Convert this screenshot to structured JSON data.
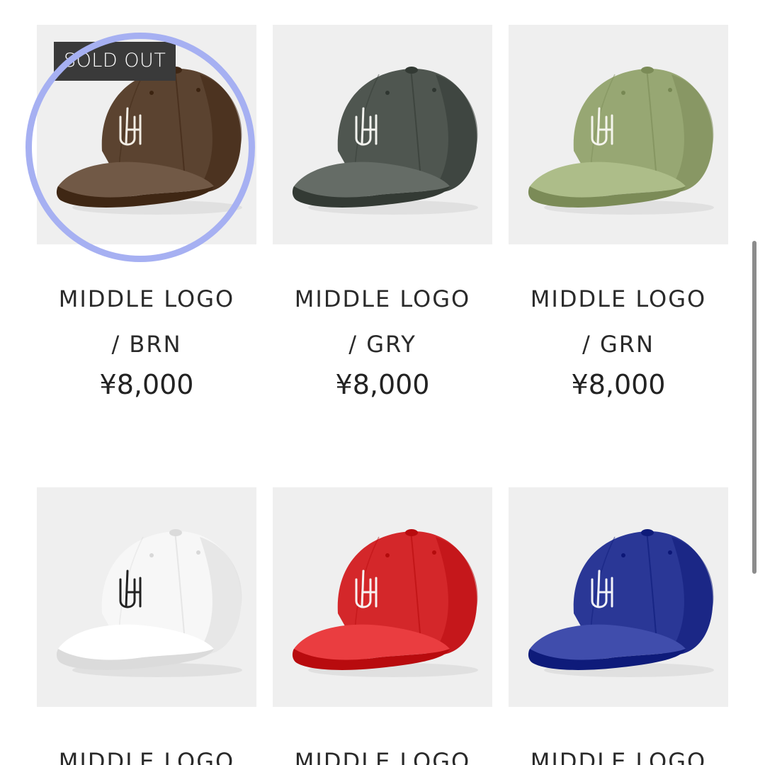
{
  "products": [
    {
      "name_line1": "MIDDLE LOGO",
      "name_line2": "/ BRN",
      "price": "¥8,000",
      "badge": "SOLD OUT",
      "cap_color": "#5b4330",
      "logo_color": "#f2ede4"
    },
    {
      "name_line1": "MIDDLE LOGO",
      "name_line2": "/ GRY",
      "price": "¥8,000",
      "cap_color": "#4f5650",
      "logo_color": "#f2f2ee"
    },
    {
      "name_line1": "MIDDLE LOGO",
      "name_line2": "/ GRN",
      "price": "¥8,000",
      "cap_color": "#97a773",
      "logo_color": "#f4f4ec"
    },
    {
      "name_line1": "MIDDLE LOGO",
      "cap_color": "#f7f7f7",
      "logo_color": "#222222"
    },
    {
      "name_line1": "MIDDLE LOGO",
      "cap_color": "#d4272a",
      "logo_color": "#f7f1f1"
    },
    {
      "name_line1": "MIDDLE LOGO",
      "cap_color": "#2a3796",
      "logo_color": "#f1f2f8"
    }
  ],
  "icons": {
    "product_image": "baseball-cap-icon"
  },
  "highlight": {
    "color": "#a6b0f2",
    "target": "products.0"
  }
}
